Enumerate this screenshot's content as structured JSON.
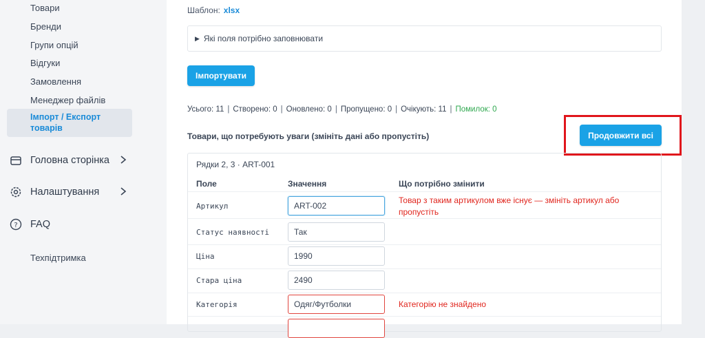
{
  "sidebar": {
    "sub_items": [
      "Товари",
      "Бренди",
      "Групи опцій",
      "Відгуки",
      "Замовлення",
      "Менеджер файлів"
    ],
    "active_item": "Імпорт / Експорт товарів",
    "main_items": [
      {
        "label": "Головна сторінка",
        "icon": "storefront-icon"
      },
      {
        "label": "Налаштування",
        "icon": "gear-icon"
      },
      {
        "label": "FAQ",
        "icon": "question-circle-icon"
      }
    ],
    "support": "Техпідтримка"
  },
  "content": {
    "template_label": "Шаблон:",
    "template_link": "xlsx",
    "details_summary": "Які поля потрібно заповнювати",
    "import_button": "Імпортувати",
    "stats": {
      "total": "Усього: 11",
      "created": "Створено: 0",
      "updated": "Оновлено: 0",
      "skipped": "Пропущено: 0",
      "pending": "Очікують: 11",
      "errors": "Помилок: 0"
    },
    "attention_title": "Товари, що потребують уваги (змініть дані або пропустіть)",
    "continue_all_button": "Продовжити всі",
    "card": {
      "title": "Рядки 2, 3 · ART-001",
      "headers": {
        "field": "Поле",
        "value": "Значення",
        "change": "Що потрібно змінити"
      },
      "rows": [
        {
          "field": "Артикул",
          "value": "ART-002",
          "note": "Товар з таким артикулом вже існує — змініть артикул або пропустіть"
        },
        {
          "field": "Статус наявності",
          "value": "Так",
          "note": ""
        },
        {
          "field": "Ціна",
          "value": "1990",
          "note": ""
        },
        {
          "field": "Стара ціна",
          "value": "2490",
          "note": ""
        },
        {
          "field": "Категорія",
          "value": "Одяг/Футболки",
          "note": "Категорію не знайдено"
        }
      ]
    }
  },
  "colors": {
    "accent": "#1aa2e6",
    "error": "#e0251d",
    "success": "#2fa84f",
    "highlight": "#e0151b"
  }
}
